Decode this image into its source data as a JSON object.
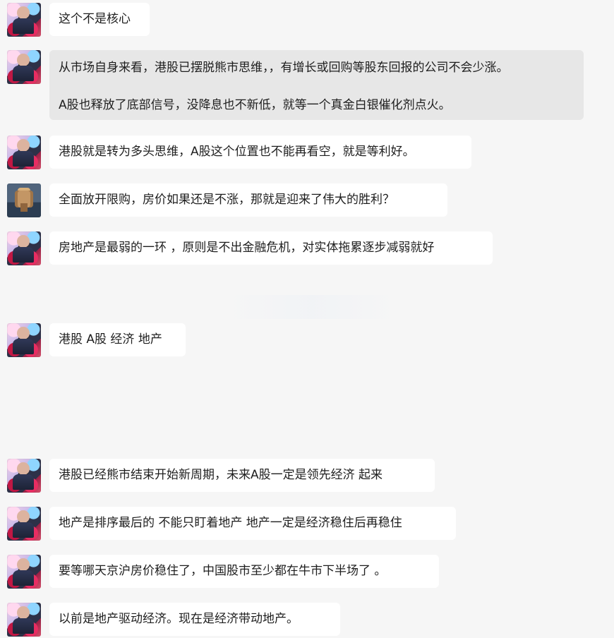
{
  "messages": [
    {
      "avatar": "user-avatar-portrait",
      "text": "这个不是核心"
    },
    {
      "avatar": "user-avatar-portrait",
      "lines": [
        "从市场自身来看，港股已摆脱熊市思维，，有增长或回购等股东回报的公司不会少涨。",
        "A股也释放了底部信号，没降息也不新低，就等一个真金白银催化剂点火。"
      ]
    },
    {
      "avatar": "user-avatar-portrait",
      "text": "港股就是转为多头思维，A股这个位置也不能再看空，就是等利好。"
    },
    {
      "avatar": "user-avatar-cartoon",
      "text": "全面放开限购，房价如果还是不涨，那就是迎来了伟大的胜利？"
    },
    {
      "avatar": "user-avatar-portrait",
      "text": "房地产是最弱的一环 ，原则是不出金融危机，对实体拖累逐步减弱就好"
    },
    {
      "avatar": "user-avatar-portrait",
      "text": "港股 A股 经济 地产"
    },
    {
      "avatar": "user-avatar-portrait",
      "text": "港股已经熊市结束开始新周期，未来A股一定是领先经济 起来"
    },
    {
      "avatar": "user-avatar-portrait",
      "text": "地产是排序最后的 不能只盯着地产 地产一定是经济稳住后再稳住"
    },
    {
      "avatar": "user-avatar-portrait",
      "text": "要等哪天京沪房价稳住了，中国股市至少都在牛市下半场了 。"
    },
    {
      "avatar": "user-avatar-portrait",
      "text": "以前是地产驱动经济。现在是经济带动地产。"
    }
  ]
}
